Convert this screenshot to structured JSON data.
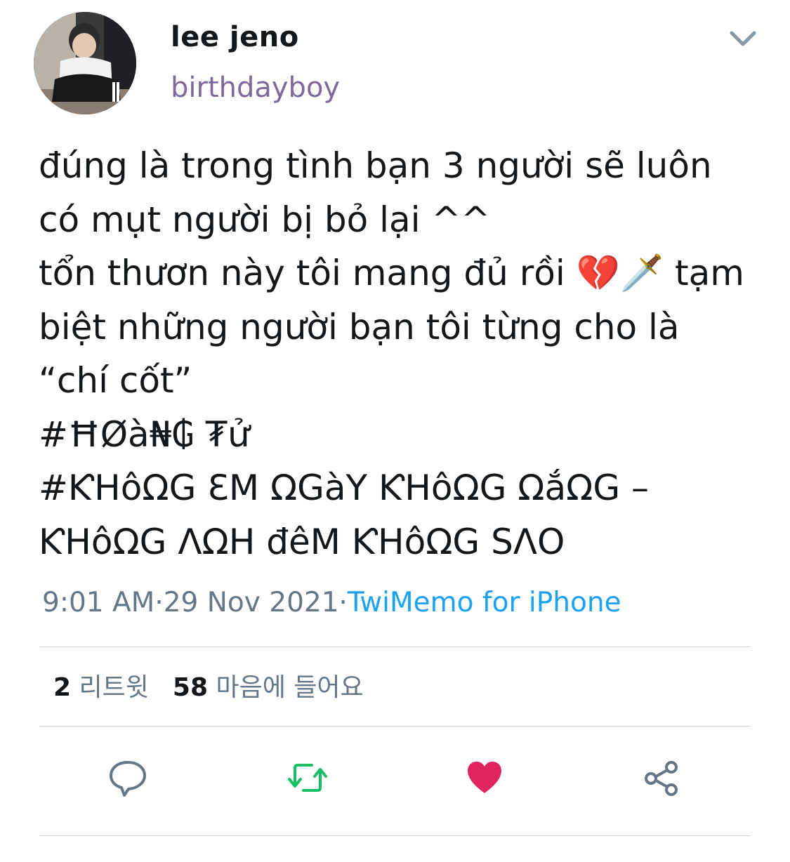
{
  "author": {
    "display_name": "lee jeno",
    "handle": "birthdayboy",
    "avatar_icon": "avatar-photo"
  },
  "menu_icon": "chevron-down-icon",
  "tweet": {
    "lines": [
      "đúng là trong tình bạn 3 người sẽ luôn",
      "có mụt người bị bỏ lại ^^",
      "tổn thươn này tôi mang đủ rồi 💔🗡️ tạm",
      "biệt những người bạn tôi từng cho là",
      "“chí cốt”",
      "#ĦØà₦₲ ₮ử",
      "#ƘHôΩG ƐM ΩGàY ƘHôΩG ΩắΩG –",
      "ƘHôΩG ΛΩH đêM ƘHôΩG SΛO"
    ]
  },
  "meta": {
    "time": "9:01 AM",
    "separator1": "·",
    "date": "29 Nov 2021",
    "separator2": "·",
    "source": "TwiMemo for iPhone"
  },
  "stats": {
    "retweets_count": "2",
    "retweets_label": "리트윗",
    "likes_count": "58",
    "likes_label": "마음에 들어요"
  },
  "actions": [
    {
      "icon": "reply-icon",
      "color": "#657786"
    },
    {
      "icon": "retweet-icon",
      "color": "#17bf63"
    },
    {
      "icon": "heart-icon",
      "color": "#e0245e"
    },
    {
      "icon": "share-icon",
      "color": "#657786"
    }
  ]
}
